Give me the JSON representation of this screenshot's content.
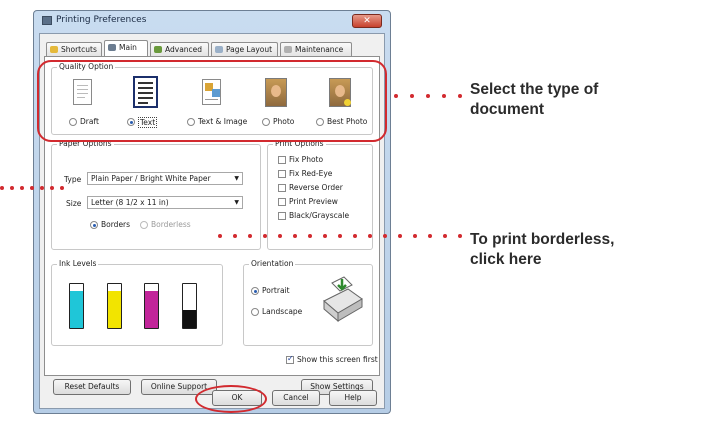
{
  "dialog": {
    "title": "Printing Preferences",
    "close_glyph": "✕",
    "tabs": [
      {
        "label": "Shortcuts",
        "icon": "star-icon"
      },
      {
        "label": "Main",
        "icon": "printer-icon",
        "active": true
      },
      {
        "label": "Advanced",
        "icon": "advanced-icon"
      },
      {
        "label": "Page Layout",
        "icon": "page-layout-icon"
      },
      {
        "label": "Maintenance",
        "icon": "maintenance-icon"
      }
    ]
  },
  "quality": {
    "title": "Quality Option",
    "options": [
      {
        "label": "Draft",
        "selected": false
      },
      {
        "label": "Text",
        "selected": true
      },
      {
        "label": "Text & Image",
        "selected": false
      },
      {
        "label": "Photo",
        "selected": false
      },
      {
        "label": "Best Photo",
        "selected": false
      }
    ]
  },
  "paper": {
    "title": "Paper Options",
    "type_label": "Type",
    "type_value": "Plain Paper / Bright White Paper",
    "size_label": "Size",
    "size_value": "Letter (8 1/2 x 11 in)",
    "borders_label": "Borders",
    "borderless_label": "Borderless"
  },
  "print_options": {
    "title": "Print Options",
    "items": [
      {
        "label": "Fix Photo",
        "checked": false
      },
      {
        "label": "Fix Red-Eye",
        "checked": false
      },
      {
        "label": "Reverse Order",
        "checked": false
      },
      {
        "label": "Print Preview",
        "checked": false
      },
      {
        "label": "Black/Grayscale",
        "checked": false
      }
    ]
  },
  "ink": {
    "title": "Ink Levels",
    "cartridges": [
      {
        "color": "#1fc6d8",
        "level": 0.85
      },
      {
        "color": "#f2e400",
        "level": 0.85
      },
      {
        "color": "#c2259a",
        "level": 0.85
      },
      {
        "color": "#111111",
        "level": 0.4
      }
    ]
  },
  "orientation": {
    "title": "Orientation",
    "portrait_label": "Portrait",
    "landscape_label": "Landscape"
  },
  "footer": {
    "show_screen_label": "Show this screen first",
    "reset_label": "Reset Defaults",
    "support_label": "Online Support",
    "show_settings_label": "Show Settings",
    "ok_label": "OK",
    "cancel_label": "Cancel",
    "help_label": "Help"
  },
  "annotations": {
    "quality_line1": "Select the type of",
    "quality_line2": "document",
    "borderless_line1": "To print borderless,",
    "borderless_line2": "click here"
  },
  "colors": {
    "highlight": "#d22a2f",
    "selected_radio": "#2a5db0"
  }
}
